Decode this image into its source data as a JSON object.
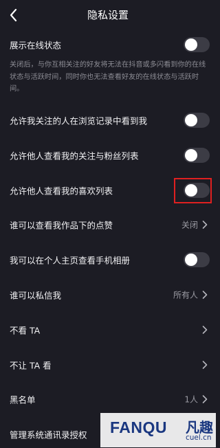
{
  "header": {
    "title": "隐私设置"
  },
  "online_status": {
    "label": "展示在线状态",
    "enabled": false,
    "description": "关闭后，与你互相关注的好友将无法在抖音或多闪看到你的在线状态与活跃时间，同时你也无法查看好友的在线状态与活跃时间。"
  },
  "toggle_rows": [
    {
      "label": "允许我关注的人在浏览记录中看到我",
      "enabled": false
    },
    {
      "label": "允许他人查看我的关注与粉丝列表",
      "enabled": false
    },
    {
      "label": "允许他人查看我的喜欢列表",
      "enabled": false
    }
  ],
  "likes_row": {
    "label": "谁可以查看我作品下的点赞",
    "value": "关闭"
  },
  "album_row": {
    "label": "我可以在个人主页查看手机相册",
    "enabled": false
  },
  "nav_rows": [
    {
      "label": "谁可以私信我",
      "value": "所有人"
    },
    {
      "label": "不看 TA",
      "value": ""
    },
    {
      "label": "不让 TA 看",
      "value": ""
    },
    {
      "label": "黑名单",
      "value": "1人"
    },
    {
      "label": "管理系统通讯录授权",
      "value": ""
    }
  ],
  "watermark": {
    "main": "FANQU",
    "cn": "凡趣",
    "sub": "cuel.cn"
  },
  "colors": {
    "background": "#1c1c24",
    "toggle_off": "#3c3c45",
    "highlight": "#e02020"
  },
  "icons": {
    "back": "chevron-left-icon",
    "row_arrow": "chevron-right-icon"
  }
}
